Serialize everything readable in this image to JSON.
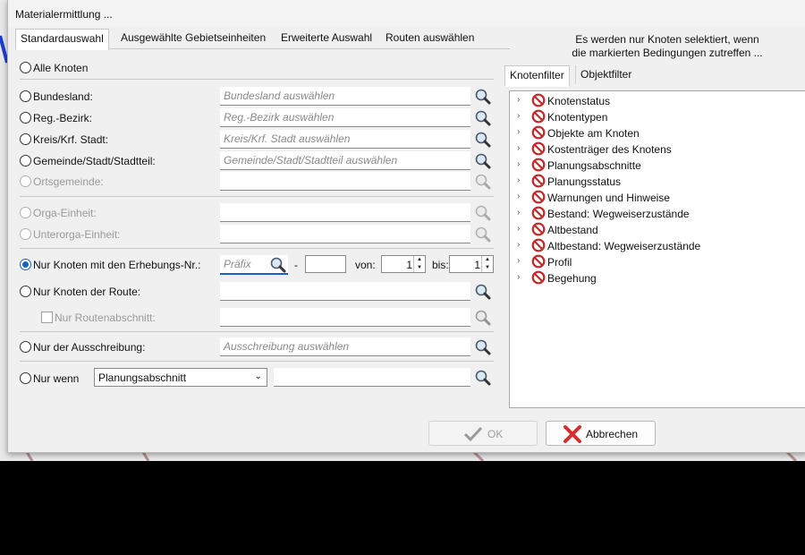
{
  "dialog": {
    "title": "Materialermittlung ..."
  },
  "tabs": [
    {
      "label": "Standardauswahl"
    },
    {
      "label": "Ausgewählte Gebietseinheiten"
    },
    {
      "label": "Erweiterte Auswahl"
    },
    {
      "label": "Routen auswählen"
    }
  ],
  "form": {
    "alle_knoten": "Alle Knoten",
    "bundesland": {
      "label": "Bundesland:",
      "placeholder": "Bundesland auswählen"
    },
    "regbezirk": {
      "label": "Reg.-Bezirk:",
      "placeholder": "Reg.-Bezirk auswählen"
    },
    "kreis": {
      "label": "Kreis/Krf. Stadt:",
      "placeholder": "Kreis/Krf. Stadt auswählen"
    },
    "gemeinde": {
      "label": "Gemeinde/Stadt/Stadtteil:",
      "placeholder": "Gemeinde/Stadt/Stadtteil auswählen"
    },
    "ortsgemeinde": {
      "label": "Ortsgemeinde:"
    },
    "orga": {
      "label": "Orga-Einheit:"
    },
    "unterorga": {
      "label": "Unterorga-Einheit:"
    },
    "erhebung": {
      "label": "Nur Knoten mit den Erhebungs-Nr.:",
      "prefix_placeholder": "Präfix",
      "dash": "-",
      "von_label": "von:",
      "von_value": "1",
      "bis_label": "bis:",
      "bis_value": "1"
    },
    "route": {
      "label": "Nur Knoten der Route:"
    },
    "routenabschnitt": {
      "label": "Nur Routenabschnitt:"
    },
    "ausschreibung": {
      "label": "Nur der Ausschreibung:",
      "placeholder": "Ausschreibung auswählen"
    },
    "nurwenn": {
      "label": "Nur wenn",
      "select_value": "Planungsabschnitt"
    }
  },
  "right": {
    "info_line1": "Es werden nur Knoten selektiert, wenn",
    "info_line2": "die markierten Bedingungen zutreffen ...",
    "tabs": [
      {
        "label": "Knotenfilter"
      },
      {
        "label": "Objektfilter"
      }
    ],
    "tree": [
      "Knotenstatus",
      "Knotentypen",
      "Objekte am Knoten",
      "Kostenträger des Knotens",
      "Planungsabschnitte",
      "Planungsstatus",
      "Warnungen und Hinweise",
      "Bestand: Wegweiserzustände",
      "Altbestand",
      "Altbestand: Wegweiserzustände",
      "Profil",
      "Begehung"
    ]
  },
  "buttons": {
    "ok": "OK",
    "cancel": "Abbrechen"
  },
  "icons": {
    "search": "magnifier-icon",
    "tree_item": "no-entry-icon",
    "ok": "checkmark-icon",
    "cancel": "red-x-icon"
  },
  "colors": {
    "accent": "#1565c0",
    "no_entry": "#c62828",
    "cancel_x": "#d32f2f"
  }
}
